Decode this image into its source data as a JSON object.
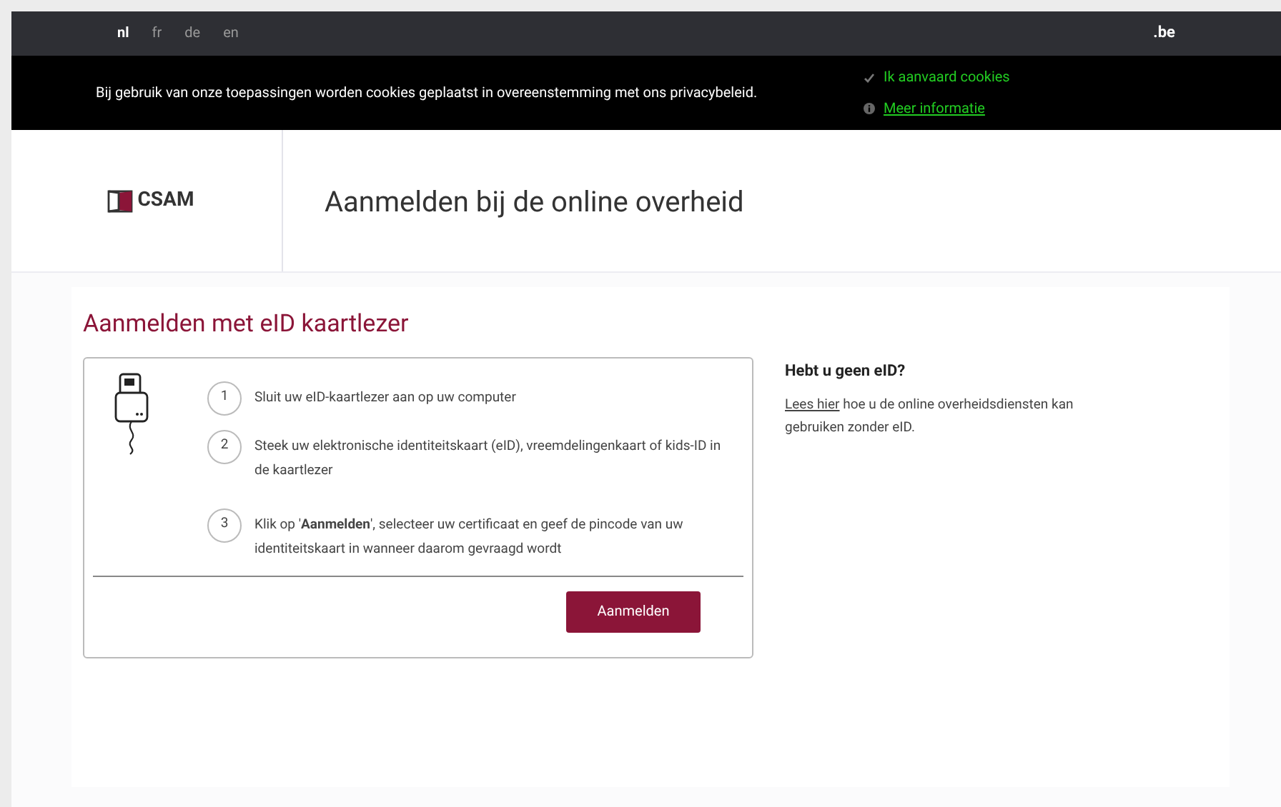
{
  "languages": [
    {
      "label": "nl",
      "selected": true
    },
    {
      "label": "fr",
      "selected": false
    },
    {
      "label": "de",
      "selected": false
    },
    {
      "label": "en",
      "selected": false
    }
  ],
  "domain": ".be",
  "cookie_bar": {
    "message": "Bij gebruik van onze toepassingen worden cookies geplaatst in overeenstemming met ons privacybeleid.",
    "accept": "Ik aanvaard cookies",
    "more_info": "Meer informatie"
  },
  "header": {
    "logo_text": "CSAM",
    "title": "Aanmelden bij de online overheid"
  },
  "section_title": "Aanmelden met eID kaartlezer",
  "steps": [
    {
      "number": "1",
      "text": "Sluit uw eID-kaartlezer aan op uw computer"
    },
    {
      "number": "2",
      "text": "Steek uw elektronische identiteitskaart (eID), vreemdelingenkaart of kids-ID in de kaartlezer"
    },
    {
      "number": "3",
      "text": "Klik op '**Aanmelden**', selecteer uw certificaat en geef de pincode van uw identiteitskaart in wanneer daarom gevraagd wordt"
    }
  ],
  "login_button": "Aanmelden",
  "aside": {
    "heading": "Hebt u geen eID?",
    "link": "Lees hier",
    "text": " hoe u de online overheidsdiensten kan gebruiken zonder eID."
  }
}
